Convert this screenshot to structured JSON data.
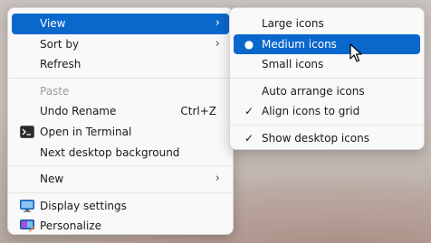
{
  "context_menu": {
    "view": "View",
    "sort_by": "Sort by",
    "refresh": "Refresh",
    "paste": "Paste",
    "undo_rename": "Undo Rename",
    "undo_shortcut": "Ctrl+Z",
    "open_terminal": "Open in Terminal",
    "next_background": "Next desktop background",
    "new": "New",
    "display_settings": "Display settings",
    "personalize": "Personalize"
  },
  "view_submenu": {
    "large_icons": "Large icons",
    "medium_icons": "Medium icons",
    "small_icons": "Small icons",
    "auto_arrange": "Auto arrange icons",
    "align_grid": "Align icons to grid",
    "show_desktop_icons": "Show desktop icons",
    "selected": "Medium icons"
  },
  "colors": {
    "highlight": "#0a67cc",
    "menu_bg": "#f9f9f9",
    "disabled_text": "#9a9a9a"
  },
  "icons": {
    "submenu_arrow": "chevron-right-icon",
    "terminal": "terminal-icon",
    "display": "monitor-icon",
    "personalize": "personalize-icon",
    "selected_option": "radio-dot-icon",
    "checked_option": "checkmark-icon"
  }
}
